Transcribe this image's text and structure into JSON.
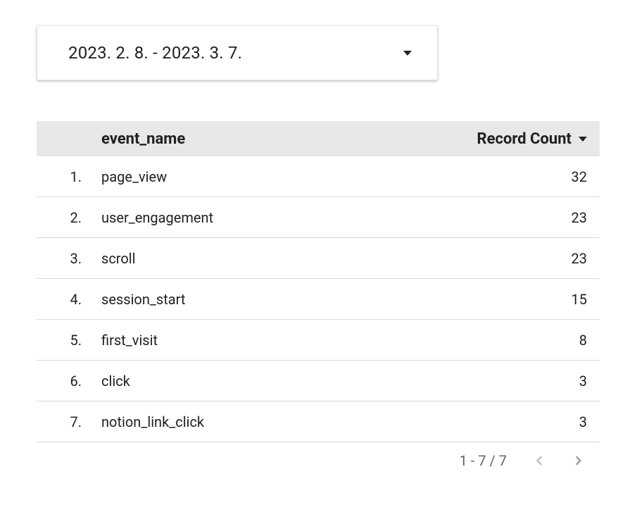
{
  "date_range": {
    "label": "2023. 2. 8. - 2023. 3. 7."
  },
  "table": {
    "columns": {
      "event_name": "event_name",
      "record_count": "Record Count"
    },
    "rows": [
      {
        "index": "1.",
        "name": "page_view",
        "count": "32"
      },
      {
        "index": "2.",
        "name": "user_engagement",
        "count": "23"
      },
      {
        "index": "3.",
        "name": "scroll",
        "count": "23"
      },
      {
        "index": "4.",
        "name": "session_start",
        "count": "15"
      },
      {
        "index": "5.",
        "name": "first_visit",
        "count": "8"
      },
      {
        "index": "6.",
        "name": "click",
        "count": "3"
      },
      {
        "index": "7.",
        "name": "notion_link_click",
        "count": "3"
      }
    ]
  },
  "pagination": {
    "info": "1 - 7 / 7"
  }
}
